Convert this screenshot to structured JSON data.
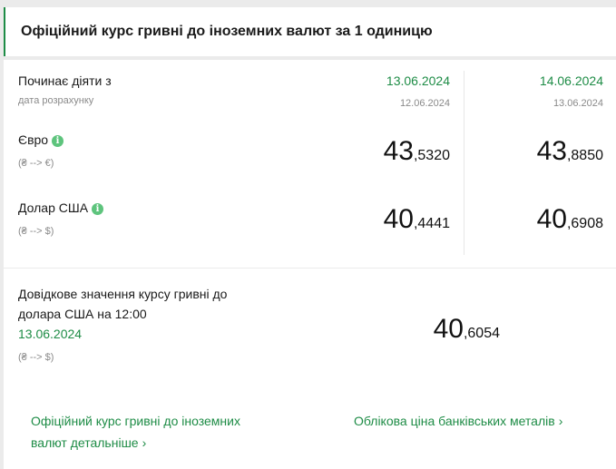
{
  "header": {
    "title": "Офіційний курс гривні до іноземних валют за 1 одиницю"
  },
  "table": {
    "starts_label": "Починає діяти з",
    "calc_date_label": "дата розрахунку",
    "columns": [
      {
        "effective_date": "13.06.2024",
        "calc_date": "12.06.2024"
      },
      {
        "effective_date": "14.06.2024",
        "calc_date": "13.06.2024"
      }
    ],
    "rows": [
      {
        "currency": "Євро",
        "direction": "(₴ --> €)",
        "info_icon": "info-icon",
        "rates": [
          {
            "int": "43",
            "dec": ",5320"
          },
          {
            "int": "43",
            "dec": ",8850"
          }
        ]
      },
      {
        "currency": "Долар США",
        "direction": "(₴ --> $)",
        "info_icon": "info-icon",
        "rates": [
          {
            "int": "40",
            "dec": ",4441"
          },
          {
            "int": "40",
            "dec": ",6908"
          }
        ]
      }
    ]
  },
  "reference": {
    "line1": "Довідкове значення курсу гривні до",
    "line2": "долара США на 12:00",
    "date": "13.06.2024",
    "direction": "(₴ --> $)",
    "rate_int": "40",
    "rate_dec": ",6054"
  },
  "links": {
    "official_line1": "Офіційний курс гривні до іноземних",
    "official_line2": "валют детальніше",
    "metals": "Облікова ціна банківських металів",
    "chevron": "›"
  },
  "colors": {
    "accent": "#1e8c46",
    "info": "#5ec47d",
    "muted": "#8a8a8a"
  }
}
